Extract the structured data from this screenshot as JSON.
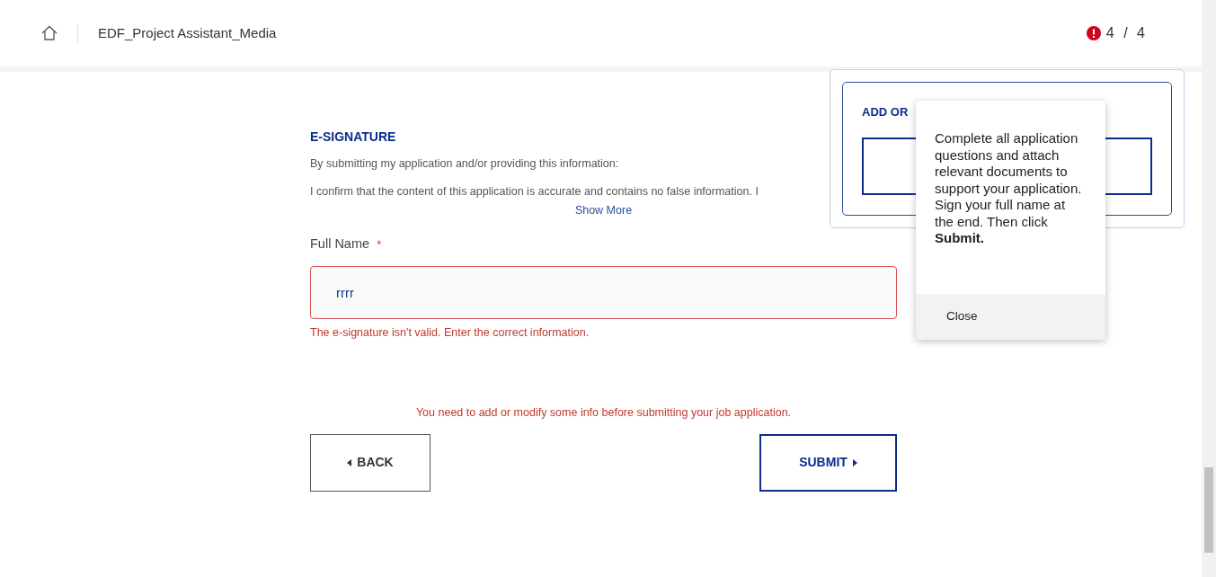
{
  "header": {
    "title": "EDF_Project Assistant_Media",
    "progress": "4 / 4"
  },
  "section": {
    "heading": "E-SIGNATURE",
    "intro": "By submitting my application and/or providing this information:",
    "statement": "I confirm that the content of this application is accurate and contains no false information. I",
    "show_more": "Show More"
  },
  "field": {
    "label": "Full Name",
    "required_mark": "*",
    "value": "rrrr",
    "invalid": true,
    "error": "The e-signature isn't valid. Enter the correct information."
  },
  "form_error": "You need to add or modify some info before submitting your job application.",
  "buttons": {
    "back": "BACK",
    "submit": "SUBMIT"
  },
  "popover": {
    "heading": "ADD OR"
  },
  "tooltip": {
    "text": "Complete all application questions and attach relevant documents to support your application. Sign your full name at the end. Then click **Submit.**",
    "close": "Close"
  }
}
